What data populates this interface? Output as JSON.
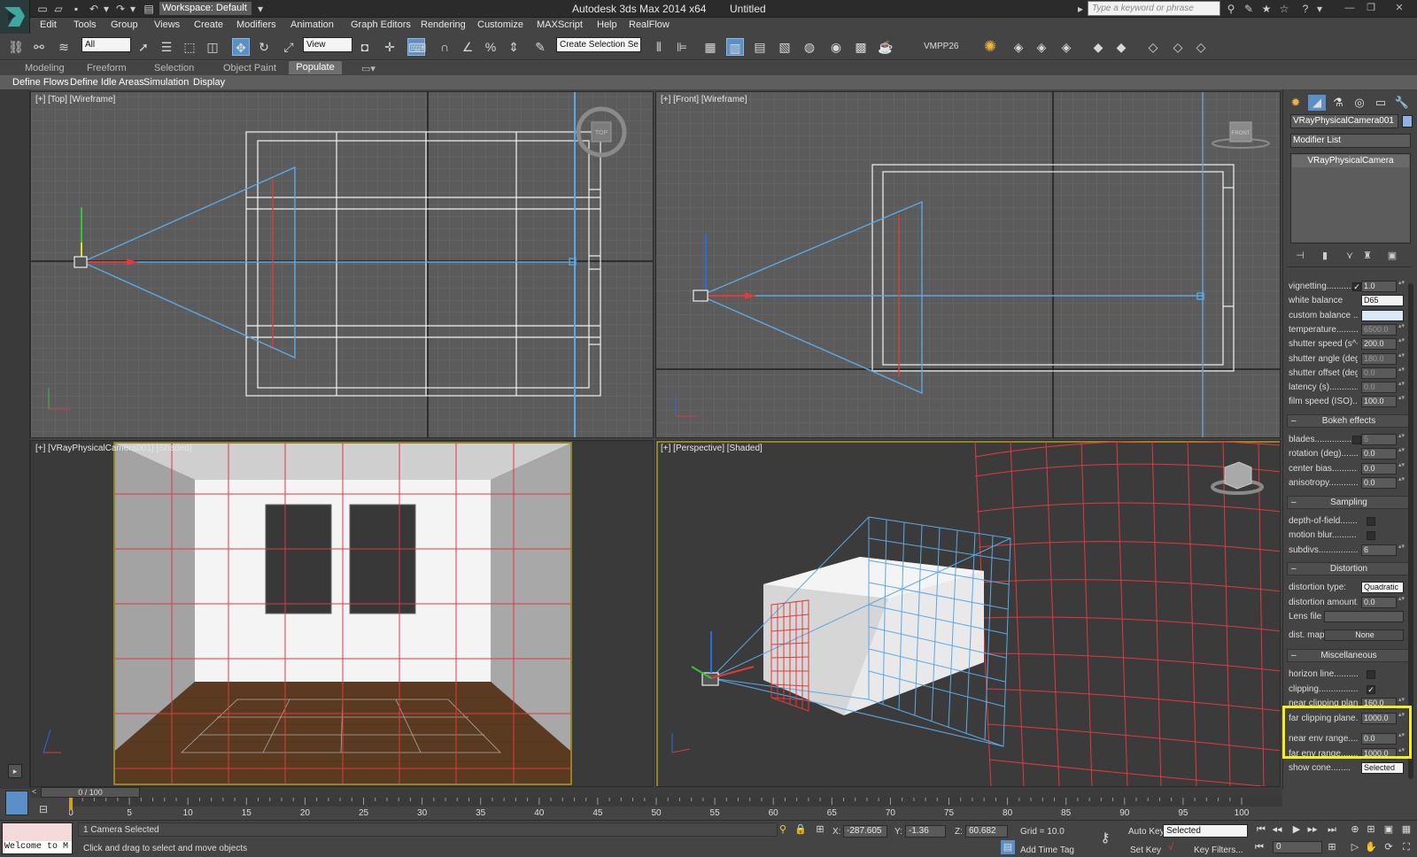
{
  "window": {
    "title": "Autodesk 3ds Max  2014 x64",
    "file": "Untitled",
    "workspace": "Workspace: Default",
    "search_placeholder": "Type a keyword or phrase"
  },
  "menu": [
    "Edit",
    "Tools",
    "Group",
    "Views",
    "Create",
    "Modifiers",
    "Animation",
    "Graph Editors",
    "Rendering",
    "Customize",
    "MAXScript",
    "Help",
    "RealFlow"
  ],
  "toolbar": {
    "selection_filter": "All",
    "ref_coord": "View",
    "named_selection": "Create Selection Se",
    "plugin_label": "VMPP26"
  },
  "ribbon": {
    "tabs": [
      "Modeling",
      "Freeform",
      "Selection",
      "Object Paint",
      "Populate"
    ],
    "active_tab": "Populate",
    "sub_tabs": [
      "Define Flows",
      "Define Idle Areas",
      "Simulation",
      "Display"
    ]
  },
  "viewports": {
    "top": "[+] [Top] [Wireframe]",
    "front": "[+] [Front] [Wireframe]",
    "camera": "[+] [VRayPhysicalCamera001] [Shaded]",
    "perspective": "[+] [Perspective] [Shaded]",
    "viewcube_top": "TOP",
    "viewcube_front": "FRONT"
  },
  "command_panel": {
    "object_name": "VRayPhysicalCamera001",
    "modifier_list": "Modifier List",
    "stack_item": "VRayPhysicalCamera",
    "params": [
      {
        "label": "vignetting..........",
        "value": "1.0",
        "check": true
      },
      {
        "label": "white balance",
        "dropdown": "D65"
      },
      {
        "label": "custom balance .....",
        "swatch": true
      },
      {
        "label": "temperature...........",
        "value": "6500.0",
        "dim": true
      },
      {
        "label": "shutter speed (s^-1",
        "value": "200.0"
      },
      {
        "label": "shutter angle (deg).",
        "value": "180.0",
        "dim": true
      },
      {
        "label": "shutter offset (deg)",
        "value": "0.0",
        "dim": true
      },
      {
        "label": "latency (s)............",
        "value": "0.0",
        "dim": true
      },
      {
        "label": "film speed (ISO).....",
        "value": "100.0"
      }
    ],
    "bokeh_header": "Bokeh effects",
    "bokeh": [
      {
        "label": "blades.................",
        "value": "5",
        "check": false,
        "dim": true
      },
      {
        "label": "rotation (deg)........",
        "value": "0.0"
      },
      {
        "label": "center bias...........",
        "value": "0.0"
      },
      {
        "label": "anisotropy............",
        "value": "0.0"
      }
    ],
    "sampling_header": "Sampling",
    "sampling": [
      {
        "label": "depth-of-field.........",
        "check": false
      },
      {
        "label": "motion blur..........",
        "check": false
      },
      {
        "label": "subdivs................",
        "value": "6"
      }
    ],
    "distortion_header": "Distortion",
    "distortion": [
      {
        "label": "distortion type:",
        "dropdown": "Quadratic"
      },
      {
        "label": "distortion amount...",
        "value": "0.0"
      },
      {
        "label": "Lens file",
        "field": ""
      },
      {
        "label": "dist. map",
        "button": "None"
      }
    ],
    "misc_header": "Miscellaneous",
    "misc": [
      {
        "label": "horizon line..........",
        "check": false
      },
      {
        "label": "clipping.................",
        "check": true
      },
      {
        "label": "near clipping plane..",
        "value": "160.0"
      },
      {
        "label": "far clipping plane....",
        "value": "1000.0"
      },
      {
        "label": "near env range.......",
        "value": "0.0"
      },
      {
        "label": "far env range.........",
        "value": "1000.0"
      },
      {
        "label": "show cone........",
        "dropdown": "Selected"
      }
    ]
  },
  "timeline": {
    "frame": "0 / 100",
    "ticks": [
      "0",
      "5",
      "10",
      "15",
      "20",
      "25",
      "30",
      "35",
      "40",
      "45",
      "50",
      "55",
      "60",
      "65",
      "70",
      "75",
      "80",
      "85",
      "90",
      "95",
      "100"
    ]
  },
  "status": {
    "welcome": "Welcome to M",
    "selection": "1 Camera Selected",
    "prompt": "Click and drag to select and move objects",
    "x_label": "X:",
    "x": "-287.605",
    "y_label": "Y:",
    "y": "-1.36",
    "z_label": "Z:",
    "z": "60.682",
    "grid": "Grid = 10.0",
    "add_time_tag": "Add Time Tag",
    "auto_key": "Auto Key",
    "set_key": "Set Key",
    "set_key_filter": "Selected",
    "key_filters": "Key Filters...",
    "current_frame": "0"
  },
  "colors": {
    "highlight": "#f5ee1a",
    "camera_blue": "#5aa9e6",
    "grid_red": "#e23a3a"
  }
}
